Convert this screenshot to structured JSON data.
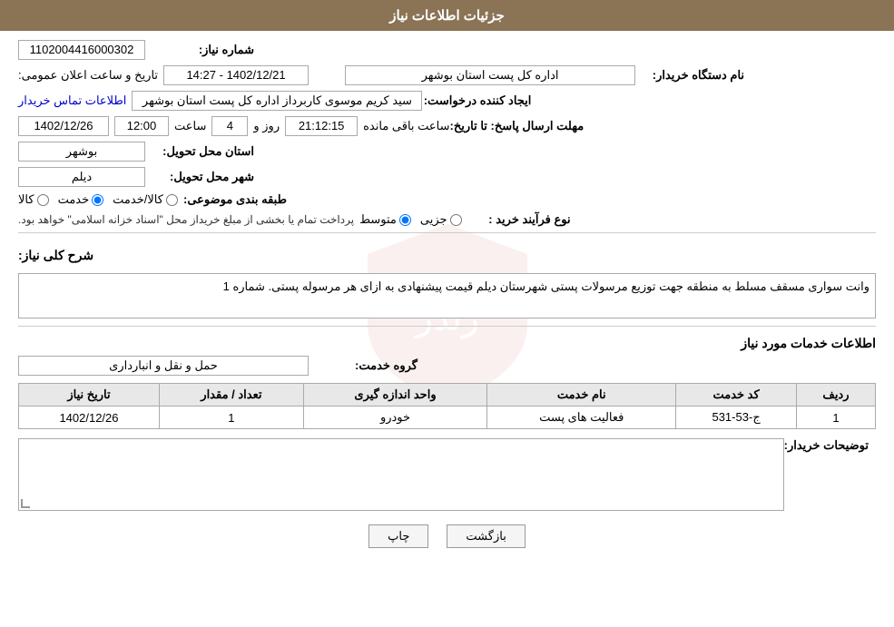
{
  "header": {
    "title": "جزئیات اطلاعات نیاز"
  },
  "fields": {
    "shomareNiaz_label": "شماره نیاز:",
    "shomareNiaz_value": "1102004416000302",
    "namDastgah_label": "نام دستگاه خریدار:",
    "namDastgah_value": "اداره کل پست استان بوشهر",
    "ijadKonande_label": "ایجاد کننده درخواست:",
    "ijadKonande_value": "سید کریم موسوی کاربرداز اداره کل پست استان بوشهر",
    "ettelaatTamas": "اطلاعات تماس خریدار",
    "mohlatErsalPasokh_label": "مهلت ارسال پاسخ: تا تاریخ:",
    "date_value": "1402/12/26",
    "saatLabel": "ساعت",
    "saat_value": "12:00",
    "roozLabel": "روز و",
    "rooz_value": "4",
    "remaining_value": "21:12:15",
    "remainingLabel": "ساعت باقی مانده",
    "ostan_label": "استان محل تحویل:",
    "ostan_value": "بوشهر",
    "shahr_label": "شهر محل تحویل:",
    "shahr_value": "دیلم",
    "tabaqeBandi_label": "طبقه بندی موضوعی:",
    "kala_label": "کالا",
    "khadamat_label": "خدمت",
    "kalaKhadamat_label": "کالا/خدمت",
    "noweFarayandKharid_label": "نوع فرآیند خرید :",
    "jozei_label": "جزیی",
    "mottaset_label": "متوسط",
    "note_text": "پرداخت تمام یا بخشی از مبلغ خریداز محل \"اسناد خزانه اسلامی\" خواهد بود.",
    "sharh_label": "شرح کلی نیاز:",
    "sharh_value": "وانت سواری مسقف مسلط به منطقه جهت توزیع مرسولات پستی شهرستان دیلم قیمت پیشنهادی به ازای هر مرسوله پستی. شماره 1",
    "groupeKhadamat_label": "گروه خدمت:",
    "groupeKhadamat_value": "حمل و نقل و انبارداری",
    "table": {
      "headers": [
        "ردیف",
        "کد خدمت",
        "نام خدمت",
        "واحد اندازه گیری",
        "تعداد / مقدار",
        "تاریخ نیاز"
      ],
      "rows": [
        {
          "radif": "1",
          "kodKhadamat": "ج-53-531",
          "namKhadamat": "فعالیت های پست",
          "vahed": "خودرو",
          "tedad": "1",
          "tarikhNiaz": "1402/12/26"
        }
      ]
    },
    "tawsifatKhariedar_label": "توضیحات خریدار:",
    "buttons": {
      "print": "چاپ",
      "back": "بازگشت"
    },
    "tarikhElanLabel": "تاریخ و ساعت اعلان عمومی:"
  },
  "tarikhe_elan_value": "1402/12/21 - 14:27"
}
